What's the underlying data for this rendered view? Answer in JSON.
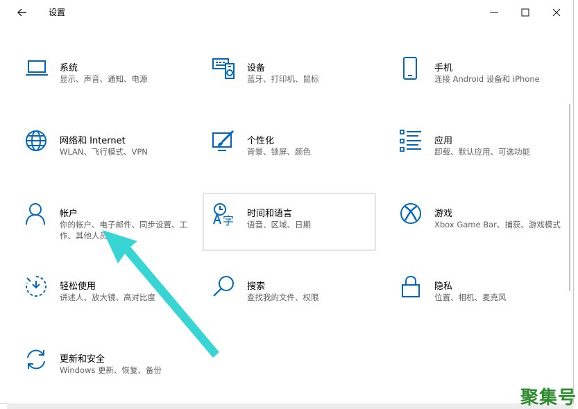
{
  "window": {
    "title": "设置"
  },
  "tiles": [
    {
      "name": "系统",
      "desc": "显示、声音、通知、电源",
      "icon": "laptop-icon"
    },
    {
      "name": "设备",
      "desc": "蓝牙、打印机、鼠标",
      "icon": "keyboard-device-icon"
    },
    {
      "name": "手机",
      "desc": "连接 Android 设备和 iPhone",
      "icon": "phone-icon"
    },
    {
      "name": "网络和 Internet",
      "desc": "WLAN、飞行模式、VPN",
      "icon": "globe-icon"
    },
    {
      "name": "个性化",
      "desc": "背景、锁屏、颜色",
      "icon": "paint-brush-icon"
    },
    {
      "name": "应用",
      "desc": "卸载、默认应用、可选功能",
      "icon": "apps-list-icon"
    },
    {
      "name": "帐户",
      "desc": "你的帐户、电子邮件、同步设置、工作、其他人员",
      "icon": "person-icon"
    },
    {
      "name": "时间和语言",
      "desc": "语音、区域、日期",
      "icon": "time-language-icon"
    },
    {
      "name": "游戏",
      "desc": "Xbox Game Bar、捕获、游戏模式",
      "icon": "xbox-icon"
    },
    {
      "name": "轻松使用",
      "desc": "讲述人、放大镜、高对比度",
      "icon": "ease-of-access-icon"
    },
    {
      "name": "搜索",
      "desc": "查找我的文件、权限",
      "icon": "search-icon"
    },
    {
      "name": "隐私",
      "desc": "位置、相机、麦克风",
      "icon": "lock-icon"
    },
    {
      "name": "更新和安全",
      "desc": "Windows 更新、恢复、备份",
      "icon": "sync-icon"
    }
  ],
  "watermark": "聚集号",
  "colors": {
    "accent": "#0067c0",
    "annotation_arrow": "#2ed3d3"
  }
}
